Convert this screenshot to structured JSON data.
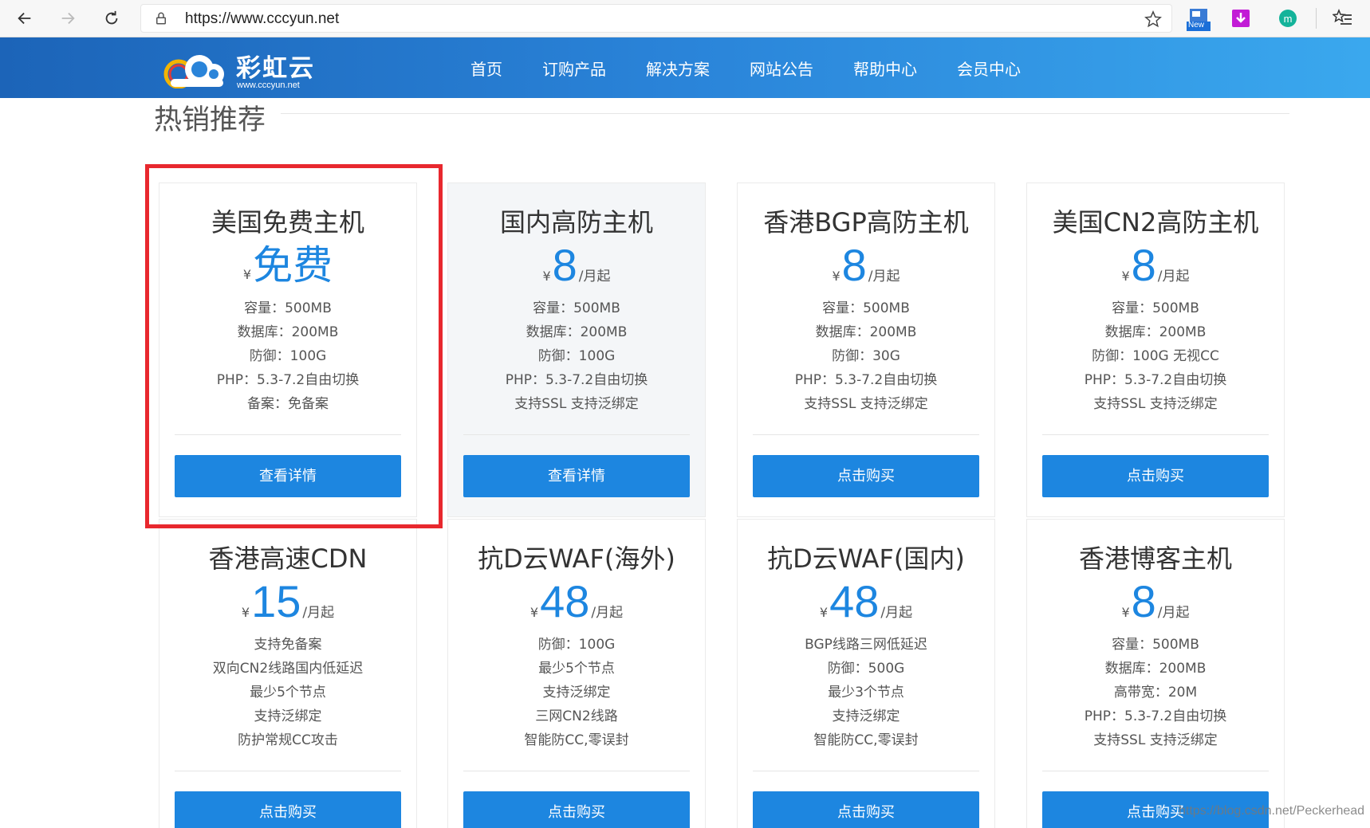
{
  "browser": {
    "url": "https://www.cccyun.net",
    "extensions": {
      "new_badge": "New",
      "m_label": "m"
    }
  },
  "site": {
    "logo_title": "彩虹云",
    "logo_sub": "www.cccyun.net",
    "nav": [
      "首页",
      "订购产品",
      "解决方案",
      "网站公告",
      "帮助中心",
      "会员中心"
    ]
  },
  "section": {
    "title": "热销推荐"
  },
  "cards": [
    {
      "name": "美国免费主机",
      "currency": "¥",
      "price": "免费",
      "unit": "",
      "features": [
        "容量：500MB",
        "数据库：200MB",
        "防御：100G",
        "PHP：5.3-7.2自由切换",
        "备案：免备案"
      ],
      "button": "查看详情"
    },
    {
      "name": "国内高防主机",
      "currency": "¥",
      "price": "8",
      "unit": "/月起",
      "features": [
        "容量：500MB",
        "数据库：200MB",
        "防御：100G",
        "PHP：5.3-7.2自由切换",
        "支持SSL 支持泛绑定"
      ],
      "button": "查看详情"
    },
    {
      "name": "香港BGP高防主机",
      "currency": "¥",
      "price": "8",
      "unit": "/月起",
      "features": [
        "容量：500MB",
        "数据库：200MB",
        "防御：30G",
        "PHP：5.3-7.2自由切换",
        "支持SSL 支持泛绑定"
      ],
      "button": "点击购买"
    },
    {
      "name": "美国CN2高防主机",
      "currency": "¥",
      "price": "8",
      "unit": "/月起",
      "features": [
        "容量：500MB",
        "数据库：200MB",
        "防御：100G 无视CC",
        "PHP：5.3-7.2自由切换",
        "支持SSL 支持泛绑定"
      ],
      "button": "点击购买"
    },
    {
      "name": "香港高速CDN",
      "currency": "¥",
      "price": "15",
      "unit": "/月起",
      "features": [
        "支持免备案",
        "双向CN2线路国内低延迟",
        "最少5个节点",
        "支持泛绑定",
        "防护常规CC攻击"
      ],
      "button": "点击购买"
    },
    {
      "name": "抗D云WAF(海外)",
      "currency": "¥",
      "price": "48",
      "unit": "/月起",
      "features": [
        "防御：100G",
        "最少5个节点",
        "支持泛绑定",
        "三网CN2线路",
        "智能防CC,零误封"
      ],
      "button": "点击购买"
    },
    {
      "name": "抗D云WAF(国内)",
      "currency": "¥",
      "price": "48",
      "unit": "/月起",
      "features": [
        "BGP线路三网低延迟",
        "防御：500G",
        "最少3个节点",
        "支持泛绑定",
        "智能防CC,零误封"
      ],
      "button": "点击购买"
    },
    {
      "name": "香港博客主机",
      "currency": "¥",
      "price": "8",
      "unit": "/月起",
      "features": [
        "容量：500MB",
        "数据库：200MB",
        "高带宽：20M",
        "PHP：5.3-7.2自由切换",
        "支持SSL 支持泛绑定"
      ],
      "button": "点击购买"
    }
  ],
  "watermark": "https://blog.csdn.net/Peckerhead",
  "colors": {
    "accent": "#1d86e0",
    "header_start": "#1c64b8",
    "header_end": "#3aa8ee",
    "highlight": "#e8282e"
  }
}
